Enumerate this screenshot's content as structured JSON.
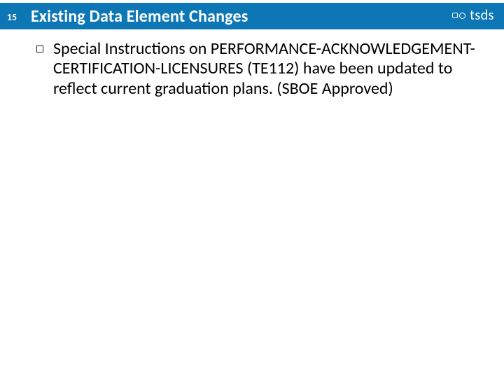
{
  "slide": {
    "page_number": "15",
    "title": "Existing Data Element Changes",
    "logo_text": "tsds"
  },
  "content": {
    "bullets": [
      "Special Instructions on PERFORMANCE-ACKNOWLEDGEMENT-CERTIFICATION-LICENSURES (TE112) have been updated to reflect current graduation plans. (SBOE Approved)"
    ]
  }
}
